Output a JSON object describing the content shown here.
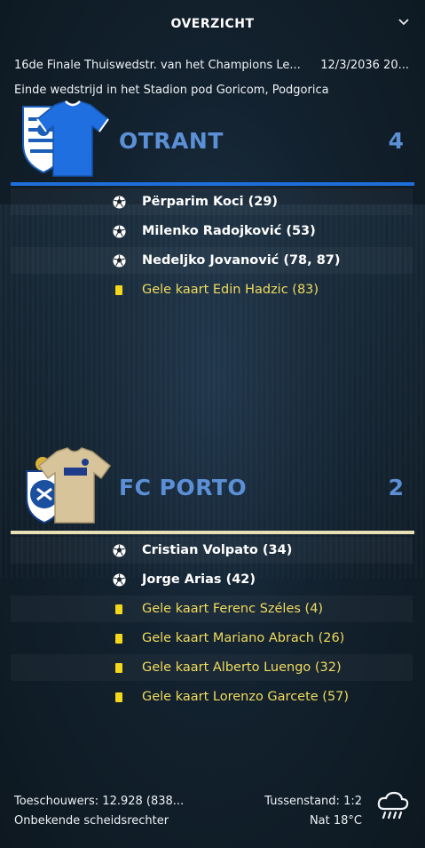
{
  "header": {
    "title": "OVERZICHT"
  },
  "match": {
    "competition": "16de Finale  Thuiswedstr. van het Champions Le...",
    "date": "12/3/2036 20...",
    "venue": "Einde wedstrijd in het Stadion pod Goricom, Podgorica"
  },
  "home": {
    "name": "OTRANT",
    "score": "4",
    "color": "#1e6fd9",
    "events": [
      {
        "type": "goal",
        "text": "Përparim Koci (29)"
      },
      {
        "type": "goal",
        "text": "Milenko Radojković (53)"
      },
      {
        "type": "goal",
        "text": "Nedeljko Jovanović (78, 87)"
      },
      {
        "type": "card",
        "text": "Gele kaart Edin Hadzic (83)"
      }
    ]
  },
  "away": {
    "name": "FC PORTO",
    "score": "2",
    "color": "#e9dfb4",
    "events": [
      {
        "type": "goal",
        "text": "Cristian Volpato (34)"
      },
      {
        "type": "goal",
        "text": "Jorge Arias (42)"
      },
      {
        "type": "card",
        "text": "Gele kaart Ferenc Széles (4)"
      },
      {
        "type": "card",
        "text": "Gele kaart Mariano Abrach (26)"
      },
      {
        "type": "card",
        "text": "Gele kaart Alberto Luengo (32)"
      },
      {
        "type": "card",
        "text": "Gele kaart Lorenzo Garcete (57)"
      }
    ]
  },
  "footer": {
    "attendance": "Toeschouwers: 12.928 (838...",
    "referee": "Onbekende scheidsrechter",
    "halftime": "Tussenstand: 1:2",
    "weather": "Nat 18°C",
    "weather_icon": "rain-cloud-icon"
  },
  "colors": {
    "card_text": "#f0db5c",
    "score": "#5b8fd6",
    "yellow_card": "#f4d81c"
  }
}
